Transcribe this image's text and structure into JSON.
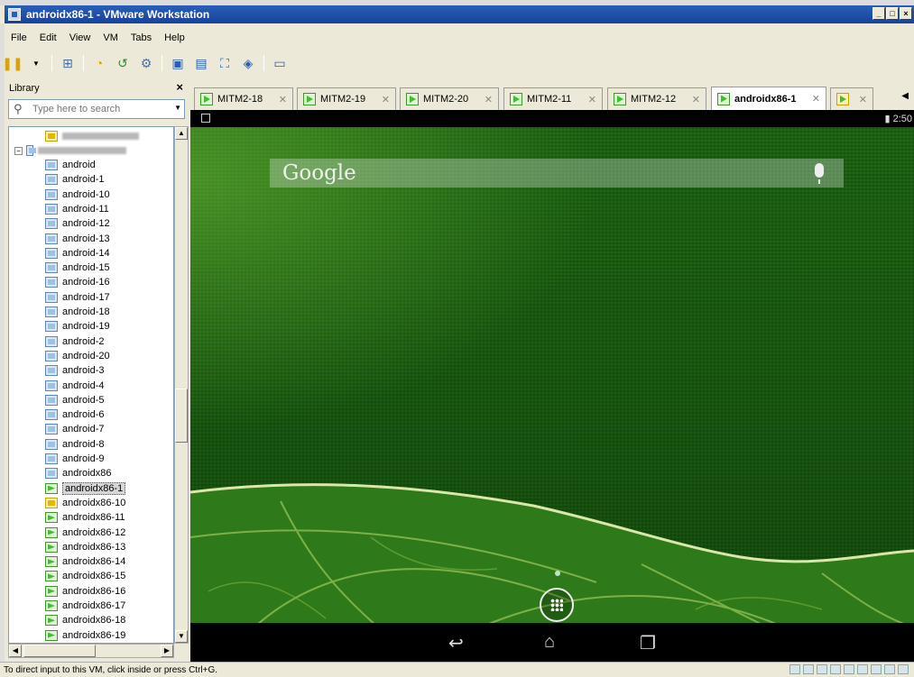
{
  "window": {
    "title": "androidx86-1 - VMware Workstation",
    "controls": [
      "_",
      "□",
      "×"
    ]
  },
  "menu": [
    "File",
    "Edit",
    "View",
    "VM",
    "Tabs",
    "Help"
  ],
  "library": {
    "header": "Library",
    "close": "×",
    "search_placeholder": "Type here to search",
    "items": [
      "android",
      "android-1",
      "android-10",
      "android-11",
      "android-12",
      "android-13",
      "android-14",
      "android-15",
      "android-16",
      "android-17",
      "android-18",
      "android-19",
      "android-2",
      "android-20",
      "android-3",
      "android-4",
      "android-5",
      "android-6",
      "android-7",
      "android-8",
      "android-9",
      "androidx86",
      "androidx86-1",
      "androidx86-10",
      "androidx86-11",
      "androidx86-12",
      "androidx86-13",
      "androidx86-14",
      "androidx86-15",
      "androidx86-16",
      "androidx86-17",
      "androidx86-18",
      "androidx86-19"
    ],
    "selected": "androidx86-1"
  },
  "tabs": [
    {
      "label": "MITM2-18"
    },
    {
      "label": "MITM2-19"
    },
    {
      "label": "MITM2-20"
    },
    {
      "label": "MITM2-11"
    },
    {
      "label": "MITM2-12"
    },
    {
      "label": "androidx86-1"
    }
  ],
  "android": {
    "time": "2:50",
    "search_label": "Google"
  },
  "status_hint": "To direct input to this VM, click inside or press Ctrl+G."
}
